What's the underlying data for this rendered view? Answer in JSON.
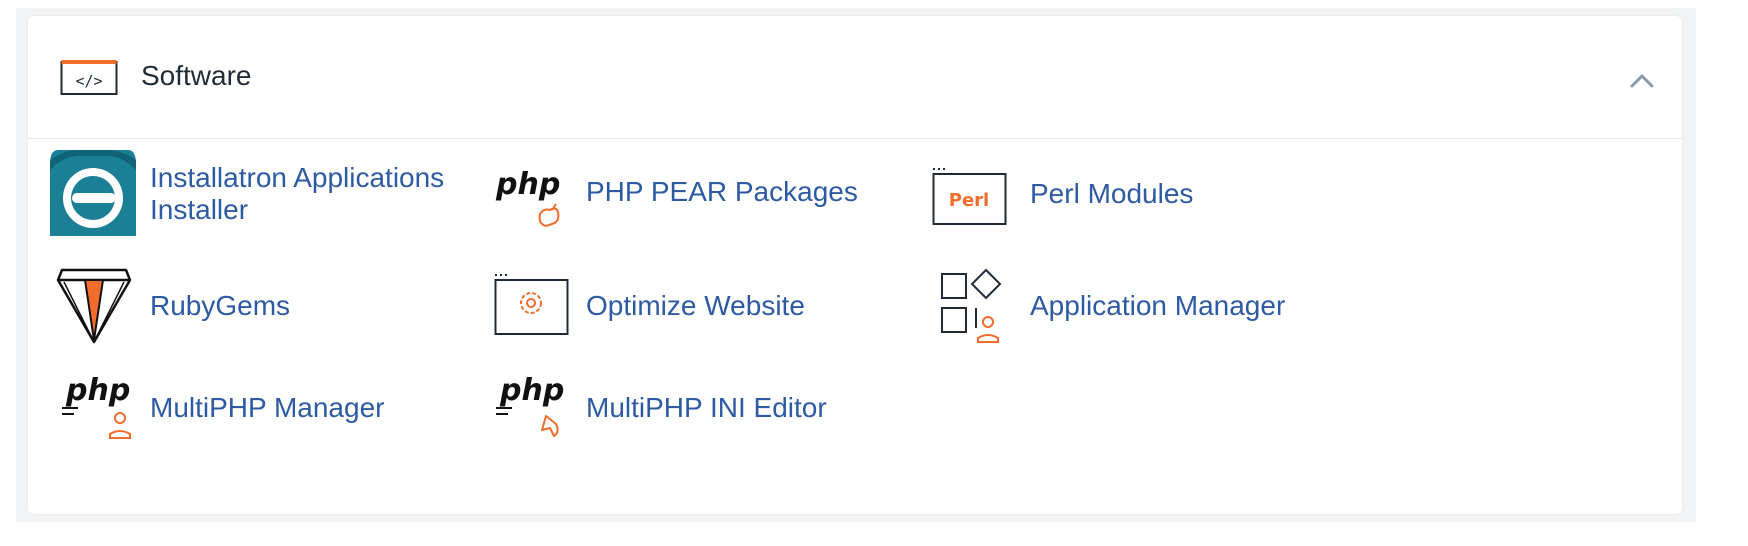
{
  "section": {
    "title": "Software",
    "collapse_icon": "chevron-up-icon"
  },
  "items": [
    {
      "label_line1": "Installatron Applications",
      "label_line2": "Installer",
      "icon": "installatron-icon"
    },
    {
      "label": "PHP PEAR Packages",
      "icon": "php-pear-icon",
      "icon_text": "php"
    },
    {
      "label": "Perl Modules",
      "icon": "perl-icon",
      "icon_text": "Perl"
    },
    {
      "label": "RubyGems",
      "icon": "ruby-gem-icon"
    },
    {
      "label": "Optimize Website",
      "icon": "optimize-website-icon"
    },
    {
      "label": "Application Manager",
      "icon": "application-manager-icon"
    },
    {
      "label": "MultiPHP Manager",
      "icon": "multiphp-manager-icon",
      "icon_text": "php"
    },
    {
      "label": "MultiPHP INI Editor",
      "icon": "multiphp-ini-editor-icon",
      "icon_text": "php"
    }
  ],
  "colors": {
    "link": "#2d5aa3",
    "accent_orange": "#f26c2b",
    "teal": "#1b7f95",
    "title_text": "#1f2b36",
    "panel_bg": "#f2f3f4"
  }
}
